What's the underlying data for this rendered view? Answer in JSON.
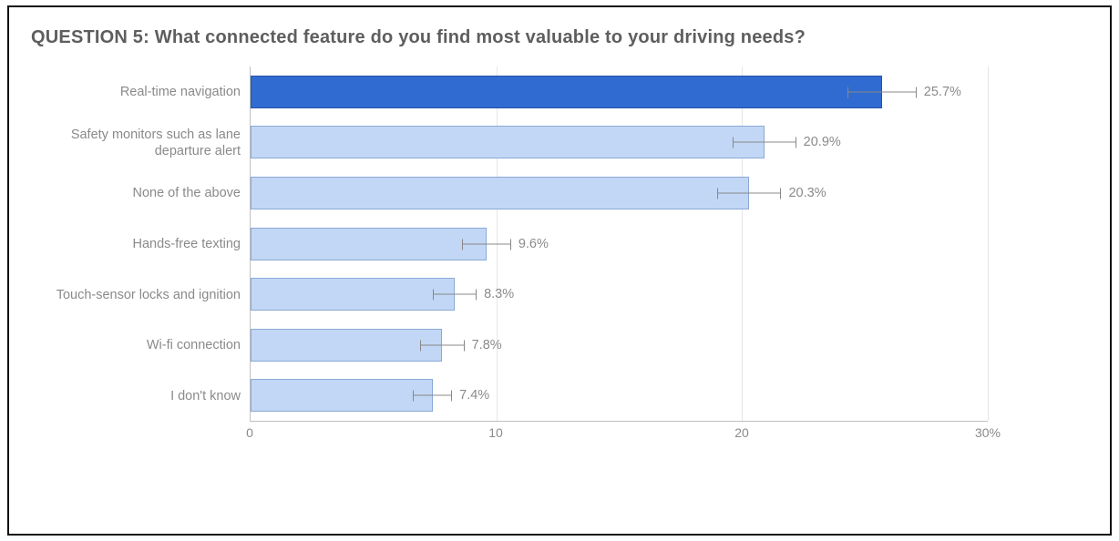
{
  "title": "QUESTION 5: What connected feature do you find most valuable to your driving needs?",
  "axis": {
    "xmax": 30,
    "ticks": [
      {
        "v": 0,
        "label": "0"
      },
      {
        "v": 10,
        "label": "10"
      },
      {
        "v": 20,
        "label": "20"
      },
      {
        "v": 30,
        "label": "30%"
      }
    ]
  },
  "rows": [
    {
      "label": "Real-time navigation",
      "value": 25.7,
      "display": "25.7%",
      "err_lo": 24.3,
      "err_hi": 27.1,
      "highlight": true
    },
    {
      "label": "Safety monitors such as lane departure alert",
      "value": 20.9,
      "display": "20.9%",
      "err_lo": 19.6,
      "err_hi": 22.2,
      "highlight": false
    },
    {
      "label": "None of the above",
      "value": 20.3,
      "display": "20.3%",
      "err_lo": 19.0,
      "err_hi": 21.6,
      "highlight": false
    },
    {
      "label": "Hands-free texting",
      "value": 9.6,
      "display": "9.6%",
      "err_lo": 8.6,
      "err_hi": 10.6,
      "highlight": false
    },
    {
      "label": "Touch-sensor locks and ignition",
      "value": 8.3,
      "display": "8.3%",
      "err_lo": 7.4,
      "err_hi": 9.2,
      "highlight": false
    },
    {
      "label": "Wi-fi connection",
      "value": 7.8,
      "display": "7.8%",
      "err_lo": 6.9,
      "err_hi": 8.7,
      "highlight": false
    },
    {
      "label": "I don't know",
      "value": 7.4,
      "display": "7.4%",
      "err_lo": 6.6,
      "err_hi": 8.2,
      "highlight": false
    }
  ],
  "chart_data": {
    "type": "bar",
    "orientation": "horizontal",
    "title": "QUESTION 5: What connected feature do you find most valuable to your driving needs?",
    "xlabel": "",
    "ylabel": "",
    "xlim": [
      0,
      30
    ],
    "x_unit": "%",
    "categories": [
      "Real-time navigation",
      "Safety monitors such as lane departure alert",
      "None of the above",
      "Hands-free texting",
      "Touch-sensor locks and ignition",
      "Wi-fi connection",
      "I don't know"
    ],
    "values": [
      25.7,
      20.9,
      20.3,
      9.6,
      8.3,
      7.8,
      7.4
    ],
    "error_bars": {
      "lo": [
        24.3,
        19.6,
        19.0,
        8.6,
        7.4,
        6.9,
        6.6
      ],
      "hi": [
        27.1,
        22.2,
        21.6,
        10.6,
        9.2,
        8.7,
        8.2
      ]
    },
    "highlight_index": 0,
    "colors": {
      "default": "#c2d7f5",
      "highlight": "#2f6bd0"
    },
    "grid": true,
    "legend": false
  }
}
